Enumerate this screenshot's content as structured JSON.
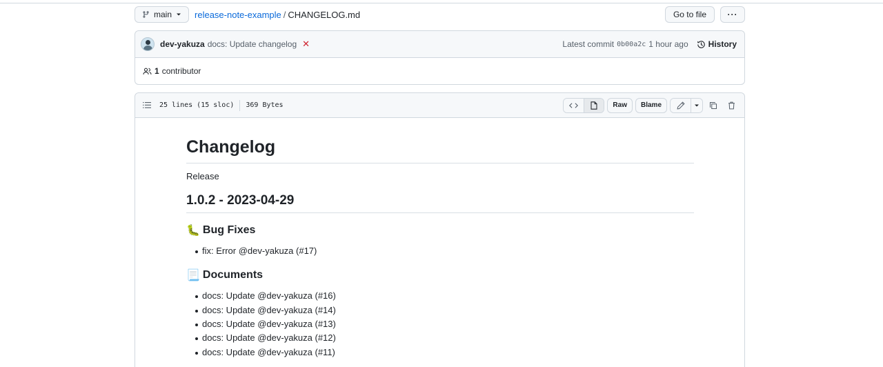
{
  "pathbar": {
    "branch": "main",
    "repo": "release-note-example",
    "separator": "/",
    "file": "CHANGELOG.md",
    "go_to_file": "Go to file",
    "more": "···"
  },
  "commit": {
    "author": "dev-yakuza",
    "message": "docs: Update changelog",
    "status": "✕",
    "latest_label": "Latest commit",
    "sha": "0b00a2c",
    "time": "1 hour ago",
    "history": "History"
  },
  "contributors": {
    "count": "1",
    "label": "contributor"
  },
  "file": {
    "lines": "25 lines (15 sloc)",
    "size": "369 Bytes",
    "raw": "Raw",
    "blame": "Blame"
  },
  "content": {
    "title": "Changelog",
    "intro": "Release",
    "version": "1.0.2 - 2023-04-29",
    "bug_section": {
      "emoji": "🐛",
      "title": "Bug Fixes",
      "items": [
        "fix: Error @dev-yakuza (#17)"
      ]
    },
    "docs_section": {
      "emoji": "📃",
      "title": "Documents",
      "items": [
        "docs: Update @dev-yakuza (#16)",
        "docs: Update @dev-yakuza (#14)",
        "docs: Update @dev-yakuza (#13)",
        "docs: Update @dev-yakuza (#12)",
        "docs: Update @dev-yakuza (#11)"
      ]
    }
  },
  "colors": {
    "link": "#0969da",
    "border": "#d0d7de",
    "header_bg": "#f6f8fa",
    "fail": "#cf222e"
  }
}
